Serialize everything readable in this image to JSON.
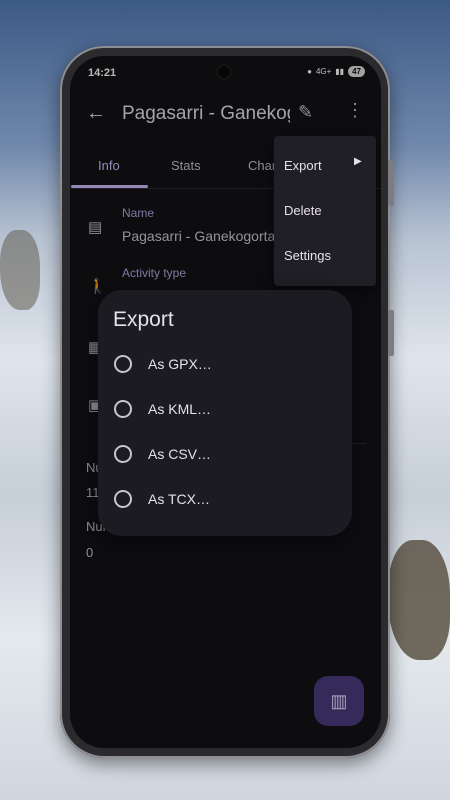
{
  "status_bar": {
    "time": "14:21",
    "network": "4G+",
    "battery": "47"
  },
  "app_bar": {
    "title": "Pagasarri - Ganekogorta"
  },
  "tabs": [
    {
      "label": "Info"
    },
    {
      "label": "Stats"
    },
    {
      "label": "Charts"
    }
  ],
  "fields": {
    "name_label": "Name",
    "name_value": "Pagasarri - Ganekogorta",
    "activity_label": "Activity type",
    "num1_label": "Number of",
    "num1_value": "11",
    "num2_label": "Number of",
    "num2_value": "0"
  },
  "overflow_menu": {
    "items": [
      {
        "label": "Export"
      },
      {
        "label": "Delete"
      },
      {
        "label": "Settings"
      }
    ]
  },
  "export_dialog": {
    "title": "Export",
    "options": [
      {
        "label": "As GPX…"
      },
      {
        "label": "As KML…"
      },
      {
        "label": "As CSV…"
      },
      {
        "label": "As TCX…"
      }
    ]
  },
  "colors": {
    "accent": "#cfbcff",
    "fab": "#4a3b7c",
    "surface": "#131217"
  }
}
